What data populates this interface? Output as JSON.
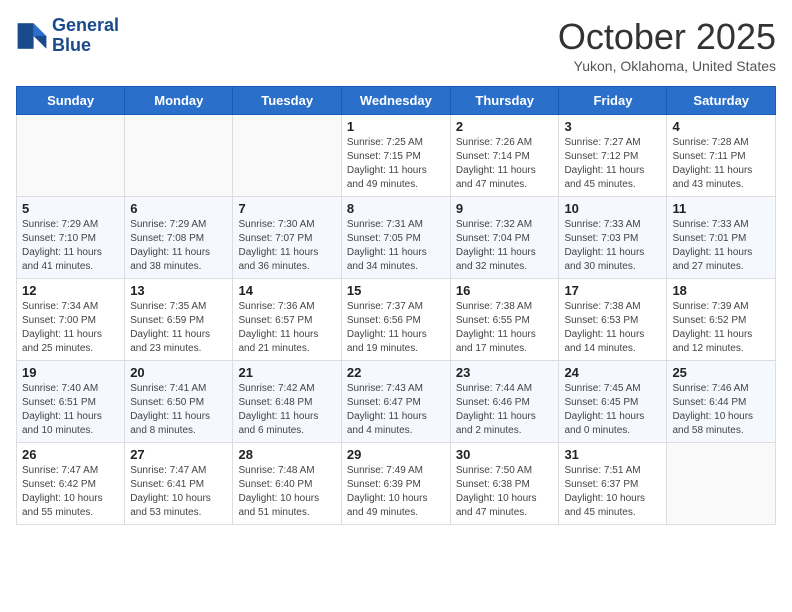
{
  "header": {
    "logo": {
      "line1": "General",
      "line2": "Blue"
    },
    "title": "October 2025",
    "subtitle": "Yukon, Oklahoma, United States"
  },
  "days_of_week": [
    "Sunday",
    "Monday",
    "Tuesday",
    "Wednesday",
    "Thursday",
    "Friday",
    "Saturday"
  ],
  "weeks": [
    [
      {
        "day": "",
        "sunrise": "",
        "sunset": "",
        "daylight": ""
      },
      {
        "day": "",
        "sunrise": "",
        "sunset": "",
        "daylight": ""
      },
      {
        "day": "",
        "sunrise": "",
        "sunset": "",
        "daylight": ""
      },
      {
        "day": "1",
        "sunrise": "Sunrise: 7:25 AM",
        "sunset": "Sunset: 7:15 PM",
        "daylight": "Daylight: 11 hours and 49 minutes."
      },
      {
        "day": "2",
        "sunrise": "Sunrise: 7:26 AM",
        "sunset": "Sunset: 7:14 PM",
        "daylight": "Daylight: 11 hours and 47 minutes."
      },
      {
        "day": "3",
        "sunrise": "Sunrise: 7:27 AM",
        "sunset": "Sunset: 7:12 PM",
        "daylight": "Daylight: 11 hours and 45 minutes."
      },
      {
        "day": "4",
        "sunrise": "Sunrise: 7:28 AM",
        "sunset": "Sunset: 7:11 PM",
        "daylight": "Daylight: 11 hours and 43 minutes."
      }
    ],
    [
      {
        "day": "5",
        "sunrise": "Sunrise: 7:29 AM",
        "sunset": "Sunset: 7:10 PM",
        "daylight": "Daylight: 11 hours and 41 minutes."
      },
      {
        "day": "6",
        "sunrise": "Sunrise: 7:29 AM",
        "sunset": "Sunset: 7:08 PM",
        "daylight": "Daylight: 11 hours and 38 minutes."
      },
      {
        "day": "7",
        "sunrise": "Sunrise: 7:30 AM",
        "sunset": "Sunset: 7:07 PM",
        "daylight": "Daylight: 11 hours and 36 minutes."
      },
      {
        "day": "8",
        "sunrise": "Sunrise: 7:31 AM",
        "sunset": "Sunset: 7:05 PM",
        "daylight": "Daylight: 11 hours and 34 minutes."
      },
      {
        "day": "9",
        "sunrise": "Sunrise: 7:32 AM",
        "sunset": "Sunset: 7:04 PM",
        "daylight": "Daylight: 11 hours and 32 minutes."
      },
      {
        "day": "10",
        "sunrise": "Sunrise: 7:33 AM",
        "sunset": "Sunset: 7:03 PM",
        "daylight": "Daylight: 11 hours and 30 minutes."
      },
      {
        "day": "11",
        "sunrise": "Sunrise: 7:33 AM",
        "sunset": "Sunset: 7:01 PM",
        "daylight": "Daylight: 11 hours and 27 minutes."
      }
    ],
    [
      {
        "day": "12",
        "sunrise": "Sunrise: 7:34 AM",
        "sunset": "Sunset: 7:00 PM",
        "daylight": "Daylight: 11 hours and 25 minutes."
      },
      {
        "day": "13",
        "sunrise": "Sunrise: 7:35 AM",
        "sunset": "Sunset: 6:59 PM",
        "daylight": "Daylight: 11 hours and 23 minutes."
      },
      {
        "day": "14",
        "sunrise": "Sunrise: 7:36 AM",
        "sunset": "Sunset: 6:57 PM",
        "daylight": "Daylight: 11 hours and 21 minutes."
      },
      {
        "day": "15",
        "sunrise": "Sunrise: 7:37 AM",
        "sunset": "Sunset: 6:56 PM",
        "daylight": "Daylight: 11 hours and 19 minutes."
      },
      {
        "day": "16",
        "sunrise": "Sunrise: 7:38 AM",
        "sunset": "Sunset: 6:55 PM",
        "daylight": "Daylight: 11 hours and 17 minutes."
      },
      {
        "day": "17",
        "sunrise": "Sunrise: 7:38 AM",
        "sunset": "Sunset: 6:53 PM",
        "daylight": "Daylight: 11 hours and 14 minutes."
      },
      {
        "day": "18",
        "sunrise": "Sunrise: 7:39 AM",
        "sunset": "Sunset: 6:52 PM",
        "daylight": "Daylight: 11 hours and 12 minutes."
      }
    ],
    [
      {
        "day": "19",
        "sunrise": "Sunrise: 7:40 AM",
        "sunset": "Sunset: 6:51 PM",
        "daylight": "Daylight: 11 hours and 10 minutes."
      },
      {
        "day": "20",
        "sunrise": "Sunrise: 7:41 AM",
        "sunset": "Sunset: 6:50 PM",
        "daylight": "Daylight: 11 hours and 8 minutes."
      },
      {
        "day": "21",
        "sunrise": "Sunrise: 7:42 AM",
        "sunset": "Sunset: 6:48 PM",
        "daylight": "Daylight: 11 hours and 6 minutes."
      },
      {
        "day": "22",
        "sunrise": "Sunrise: 7:43 AM",
        "sunset": "Sunset: 6:47 PM",
        "daylight": "Daylight: 11 hours and 4 minutes."
      },
      {
        "day": "23",
        "sunrise": "Sunrise: 7:44 AM",
        "sunset": "Sunset: 6:46 PM",
        "daylight": "Daylight: 11 hours and 2 minutes."
      },
      {
        "day": "24",
        "sunrise": "Sunrise: 7:45 AM",
        "sunset": "Sunset: 6:45 PM",
        "daylight": "Daylight: 11 hours and 0 minutes."
      },
      {
        "day": "25",
        "sunrise": "Sunrise: 7:46 AM",
        "sunset": "Sunset: 6:44 PM",
        "daylight": "Daylight: 10 hours and 58 minutes."
      }
    ],
    [
      {
        "day": "26",
        "sunrise": "Sunrise: 7:47 AM",
        "sunset": "Sunset: 6:42 PM",
        "daylight": "Daylight: 10 hours and 55 minutes."
      },
      {
        "day": "27",
        "sunrise": "Sunrise: 7:47 AM",
        "sunset": "Sunset: 6:41 PM",
        "daylight": "Daylight: 10 hours and 53 minutes."
      },
      {
        "day": "28",
        "sunrise": "Sunrise: 7:48 AM",
        "sunset": "Sunset: 6:40 PM",
        "daylight": "Daylight: 10 hours and 51 minutes."
      },
      {
        "day": "29",
        "sunrise": "Sunrise: 7:49 AM",
        "sunset": "Sunset: 6:39 PM",
        "daylight": "Daylight: 10 hours and 49 minutes."
      },
      {
        "day": "30",
        "sunrise": "Sunrise: 7:50 AM",
        "sunset": "Sunset: 6:38 PM",
        "daylight": "Daylight: 10 hours and 47 minutes."
      },
      {
        "day": "31",
        "sunrise": "Sunrise: 7:51 AM",
        "sunset": "Sunset: 6:37 PM",
        "daylight": "Daylight: 10 hours and 45 minutes."
      },
      {
        "day": "",
        "sunrise": "",
        "sunset": "",
        "daylight": ""
      }
    ]
  ]
}
